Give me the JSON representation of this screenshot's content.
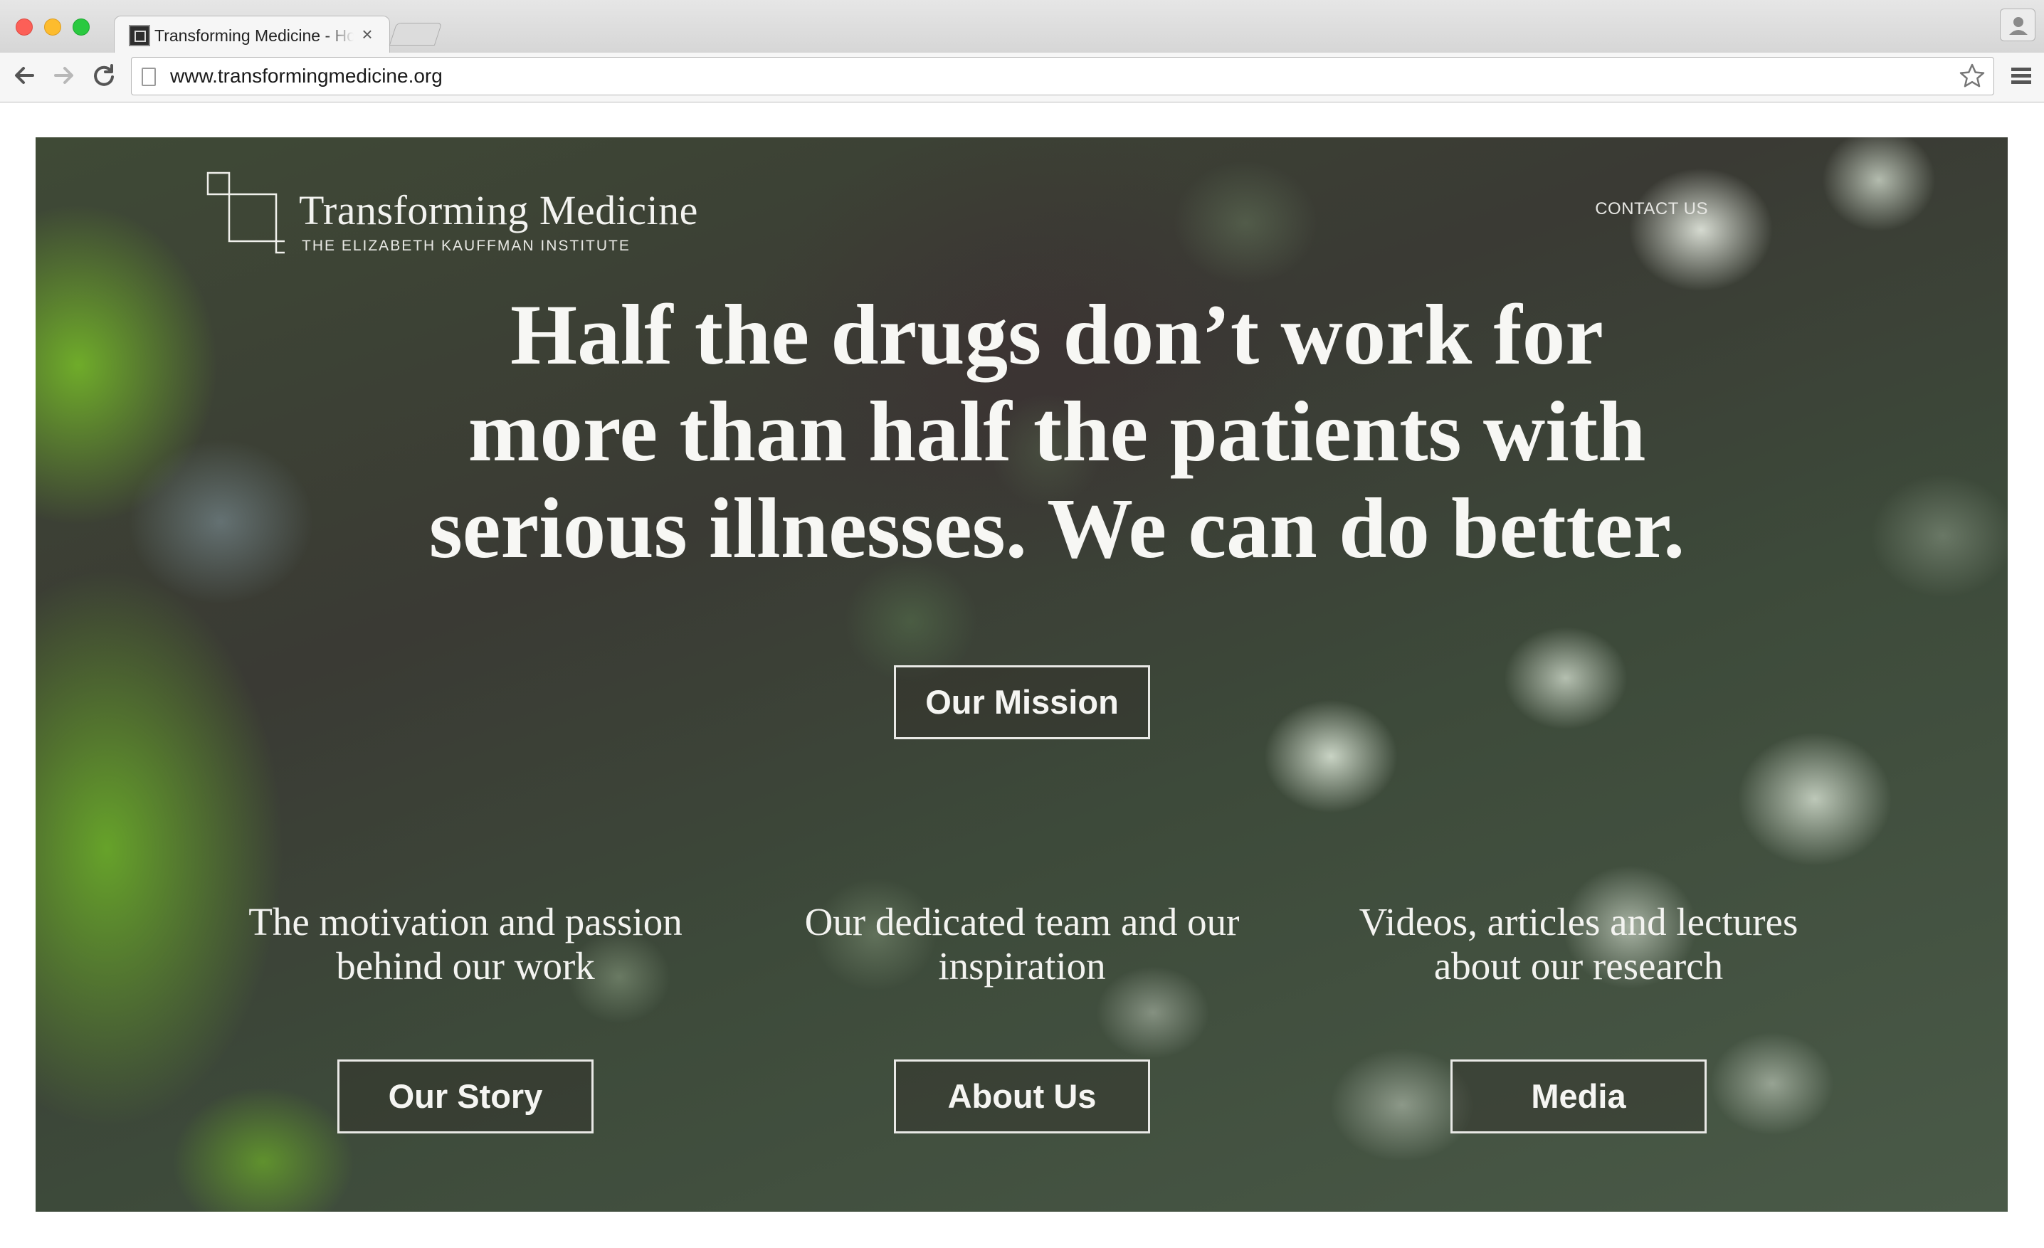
{
  "browser": {
    "tab_title": "Transforming Medicine - Home",
    "tab_close": "×",
    "url": "www.transformingmedicine.org"
  },
  "site": {
    "brand_name": "Transforming Medicine",
    "brand_subtitle": "THE ELIZABETH KAUFFMAN INSTITUTE",
    "contact_label": "CONTACT US"
  },
  "hero": {
    "headline_line1": "Half the drugs don’t work for",
    "headline_line2": "more than half the patients with",
    "headline_line3": "serious illnesses. We can do better.",
    "mission_button": "Our Mission"
  },
  "sections": [
    {
      "line1": "The motivation and passion",
      "line2": "behind our work",
      "button": "Our Story"
    },
    {
      "line1": "Our dedicated team and our",
      "line2": "inspiration",
      "button": "About Us"
    },
    {
      "line1": "Videos, articles and lectures",
      "line2": "about our research",
      "button": "Media"
    }
  ],
  "colors": {
    "hero_text": "#f7f7f4",
    "button_border": "#e9e9e6",
    "hero_background": "#3d4a3a",
    "accent_green": "#78be28"
  },
  "icons": [
    "back-arrow-icon",
    "forward-arrow-icon",
    "reload-icon",
    "page-icon",
    "bookmark-star-icon",
    "hamburger-menu-icon",
    "profile-icon"
  ]
}
